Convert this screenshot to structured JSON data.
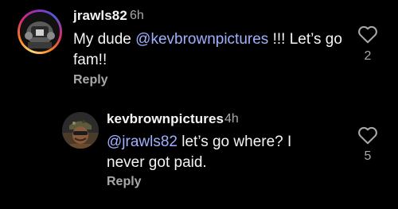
{
  "comments": [
    {
      "username": "jrawls82",
      "time": "6h",
      "text_prefix": "My dude ",
      "mention": "@kevbrownpictures",
      "text_suffix": " !!! Let’s go fam!!",
      "reply_label": "Reply",
      "like_count": "2"
    },
    {
      "username": "kevbrownpictures",
      "time": "4h",
      "text_prefix": "",
      "mention": "@jrawls82",
      "text_suffix": " let’s go where? I never got paid.",
      "reply_label": "Reply",
      "like_count": "5"
    }
  ],
  "colors": {
    "background": "#000000",
    "text": "#f5f5f5",
    "secondary": "#a8a8a8",
    "mention": "#a0b0ff"
  },
  "icons": {
    "like": "heart-outline-icon"
  }
}
